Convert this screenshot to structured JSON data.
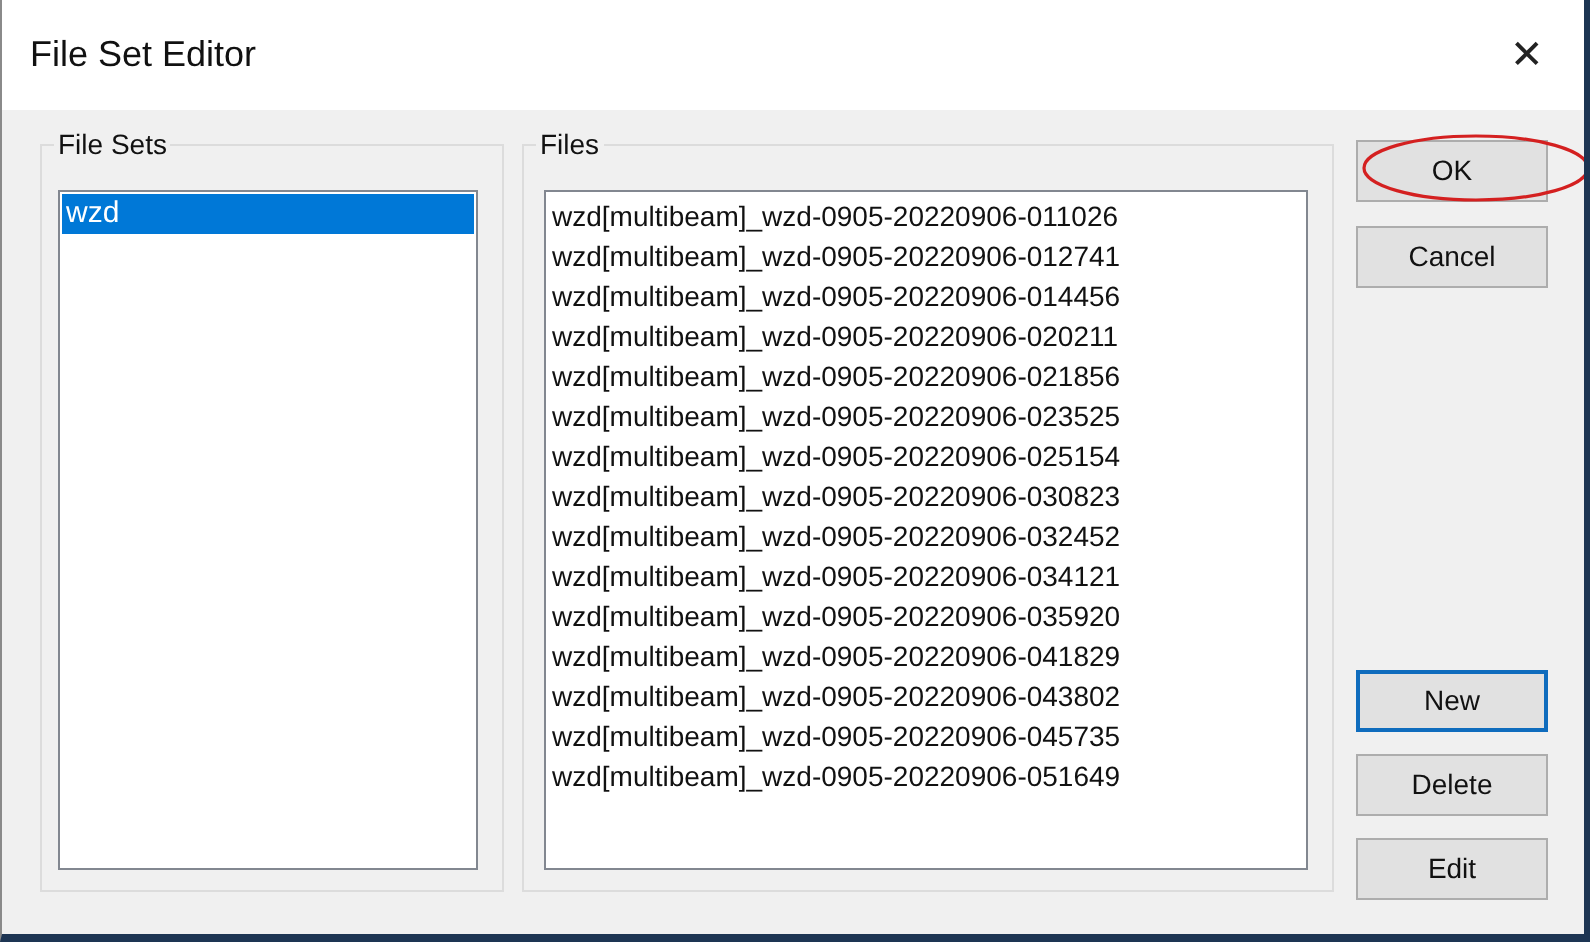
{
  "window": {
    "title": "File Set Editor",
    "close": "✕"
  },
  "file_sets": {
    "label": "File Sets",
    "items": [
      {
        "name": "wzd",
        "selected": true
      }
    ]
  },
  "files": {
    "label": "Files",
    "items": [
      "wzd[multibeam]_wzd-0905-20220906-011026",
      "wzd[multibeam]_wzd-0905-20220906-012741",
      "wzd[multibeam]_wzd-0905-20220906-014456",
      "wzd[multibeam]_wzd-0905-20220906-020211",
      "wzd[multibeam]_wzd-0905-20220906-021856",
      "wzd[multibeam]_wzd-0905-20220906-023525",
      "wzd[multibeam]_wzd-0905-20220906-025154",
      "wzd[multibeam]_wzd-0905-20220906-030823",
      "wzd[multibeam]_wzd-0905-20220906-032452",
      "wzd[multibeam]_wzd-0905-20220906-034121",
      "wzd[multibeam]_wzd-0905-20220906-035920",
      "wzd[multibeam]_wzd-0905-20220906-041829",
      "wzd[multibeam]_wzd-0905-20220906-043802",
      "wzd[multibeam]_wzd-0905-20220906-045735",
      "wzd[multibeam]_wzd-0905-20220906-051649"
    ]
  },
  "top_buttons": [
    {
      "label": "OK",
      "focused": false,
      "circled": true
    },
    {
      "label": "Cancel",
      "focused": false,
      "circled": false
    }
  ],
  "bottom_buttons": [
    {
      "label": "New",
      "focused": true,
      "circled": false
    },
    {
      "label": "Delete",
      "focused": false,
      "circled": false
    },
    {
      "label": "Edit",
      "focused": false,
      "circled": false
    }
  ]
}
